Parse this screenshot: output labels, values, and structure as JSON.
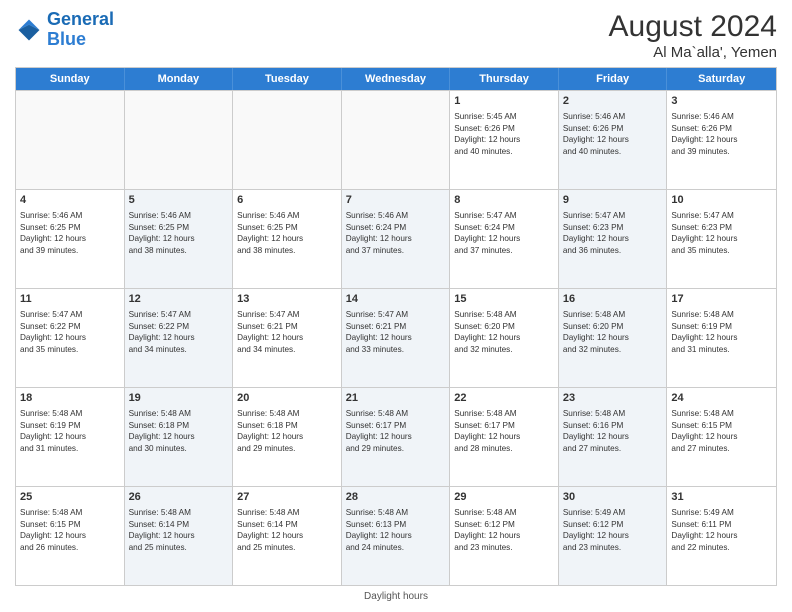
{
  "header": {
    "logo_line1": "General",
    "logo_line2": "Blue",
    "main_title": "August 2024",
    "sub_title": "Al Ma`alla', Yemen"
  },
  "weekdays": [
    "Sunday",
    "Monday",
    "Tuesday",
    "Wednesday",
    "Thursday",
    "Friday",
    "Saturday"
  ],
  "footer": {
    "daylight_label": "Daylight hours"
  },
  "rows": [
    [
      {
        "day": "",
        "empty": true,
        "shaded": false,
        "lines": []
      },
      {
        "day": "",
        "empty": true,
        "shaded": false,
        "lines": []
      },
      {
        "day": "",
        "empty": true,
        "shaded": false,
        "lines": []
      },
      {
        "day": "",
        "empty": true,
        "shaded": false,
        "lines": []
      },
      {
        "day": "1",
        "empty": false,
        "shaded": false,
        "lines": [
          "Sunrise: 5:45 AM",
          "Sunset: 6:26 PM",
          "Daylight: 12 hours",
          "and 40 minutes."
        ]
      },
      {
        "day": "2",
        "empty": false,
        "shaded": true,
        "lines": [
          "Sunrise: 5:46 AM",
          "Sunset: 6:26 PM",
          "Daylight: 12 hours",
          "and 40 minutes."
        ]
      },
      {
        "day": "3",
        "empty": false,
        "shaded": false,
        "lines": [
          "Sunrise: 5:46 AM",
          "Sunset: 6:26 PM",
          "Daylight: 12 hours",
          "and 39 minutes."
        ]
      }
    ],
    [
      {
        "day": "4",
        "empty": false,
        "shaded": false,
        "lines": [
          "Sunrise: 5:46 AM",
          "Sunset: 6:25 PM",
          "Daylight: 12 hours",
          "and 39 minutes."
        ]
      },
      {
        "day": "5",
        "empty": false,
        "shaded": true,
        "lines": [
          "Sunrise: 5:46 AM",
          "Sunset: 6:25 PM",
          "Daylight: 12 hours",
          "and 38 minutes."
        ]
      },
      {
        "day": "6",
        "empty": false,
        "shaded": false,
        "lines": [
          "Sunrise: 5:46 AM",
          "Sunset: 6:25 PM",
          "Daylight: 12 hours",
          "and 38 minutes."
        ]
      },
      {
        "day": "7",
        "empty": false,
        "shaded": true,
        "lines": [
          "Sunrise: 5:46 AM",
          "Sunset: 6:24 PM",
          "Daylight: 12 hours",
          "and 37 minutes."
        ]
      },
      {
        "day": "8",
        "empty": false,
        "shaded": false,
        "lines": [
          "Sunrise: 5:47 AM",
          "Sunset: 6:24 PM",
          "Daylight: 12 hours",
          "and 37 minutes."
        ]
      },
      {
        "day": "9",
        "empty": false,
        "shaded": true,
        "lines": [
          "Sunrise: 5:47 AM",
          "Sunset: 6:23 PM",
          "Daylight: 12 hours",
          "and 36 minutes."
        ]
      },
      {
        "day": "10",
        "empty": false,
        "shaded": false,
        "lines": [
          "Sunrise: 5:47 AM",
          "Sunset: 6:23 PM",
          "Daylight: 12 hours",
          "and 35 minutes."
        ]
      }
    ],
    [
      {
        "day": "11",
        "empty": false,
        "shaded": false,
        "lines": [
          "Sunrise: 5:47 AM",
          "Sunset: 6:22 PM",
          "Daylight: 12 hours",
          "and 35 minutes."
        ]
      },
      {
        "day": "12",
        "empty": false,
        "shaded": true,
        "lines": [
          "Sunrise: 5:47 AM",
          "Sunset: 6:22 PM",
          "Daylight: 12 hours",
          "and 34 minutes."
        ]
      },
      {
        "day": "13",
        "empty": false,
        "shaded": false,
        "lines": [
          "Sunrise: 5:47 AM",
          "Sunset: 6:21 PM",
          "Daylight: 12 hours",
          "and 34 minutes."
        ]
      },
      {
        "day": "14",
        "empty": false,
        "shaded": true,
        "lines": [
          "Sunrise: 5:47 AM",
          "Sunset: 6:21 PM",
          "Daylight: 12 hours",
          "and 33 minutes."
        ]
      },
      {
        "day": "15",
        "empty": false,
        "shaded": false,
        "lines": [
          "Sunrise: 5:48 AM",
          "Sunset: 6:20 PM",
          "Daylight: 12 hours",
          "and 32 minutes."
        ]
      },
      {
        "day": "16",
        "empty": false,
        "shaded": true,
        "lines": [
          "Sunrise: 5:48 AM",
          "Sunset: 6:20 PM",
          "Daylight: 12 hours",
          "and 32 minutes."
        ]
      },
      {
        "day": "17",
        "empty": false,
        "shaded": false,
        "lines": [
          "Sunrise: 5:48 AM",
          "Sunset: 6:19 PM",
          "Daylight: 12 hours",
          "and 31 minutes."
        ]
      }
    ],
    [
      {
        "day": "18",
        "empty": false,
        "shaded": false,
        "lines": [
          "Sunrise: 5:48 AM",
          "Sunset: 6:19 PM",
          "Daylight: 12 hours",
          "and 31 minutes."
        ]
      },
      {
        "day": "19",
        "empty": false,
        "shaded": true,
        "lines": [
          "Sunrise: 5:48 AM",
          "Sunset: 6:18 PM",
          "Daylight: 12 hours",
          "and 30 minutes."
        ]
      },
      {
        "day": "20",
        "empty": false,
        "shaded": false,
        "lines": [
          "Sunrise: 5:48 AM",
          "Sunset: 6:18 PM",
          "Daylight: 12 hours",
          "and 29 minutes."
        ]
      },
      {
        "day": "21",
        "empty": false,
        "shaded": true,
        "lines": [
          "Sunrise: 5:48 AM",
          "Sunset: 6:17 PM",
          "Daylight: 12 hours",
          "and 29 minutes."
        ]
      },
      {
        "day": "22",
        "empty": false,
        "shaded": false,
        "lines": [
          "Sunrise: 5:48 AM",
          "Sunset: 6:17 PM",
          "Daylight: 12 hours",
          "and 28 minutes."
        ]
      },
      {
        "day": "23",
        "empty": false,
        "shaded": true,
        "lines": [
          "Sunrise: 5:48 AM",
          "Sunset: 6:16 PM",
          "Daylight: 12 hours",
          "and 27 minutes."
        ]
      },
      {
        "day": "24",
        "empty": false,
        "shaded": false,
        "lines": [
          "Sunrise: 5:48 AM",
          "Sunset: 6:15 PM",
          "Daylight: 12 hours",
          "and 27 minutes."
        ]
      }
    ],
    [
      {
        "day": "25",
        "empty": false,
        "shaded": false,
        "lines": [
          "Sunrise: 5:48 AM",
          "Sunset: 6:15 PM",
          "Daylight: 12 hours",
          "and 26 minutes."
        ]
      },
      {
        "day": "26",
        "empty": false,
        "shaded": true,
        "lines": [
          "Sunrise: 5:48 AM",
          "Sunset: 6:14 PM",
          "Daylight: 12 hours",
          "and 25 minutes."
        ]
      },
      {
        "day": "27",
        "empty": false,
        "shaded": false,
        "lines": [
          "Sunrise: 5:48 AM",
          "Sunset: 6:14 PM",
          "Daylight: 12 hours",
          "and 25 minutes."
        ]
      },
      {
        "day": "28",
        "empty": false,
        "shaded": true,
        "lines": [
          "Sunrise: 5:48 AM",
          "Sunset: 6:13 PM",
          "Daylight: 12 hours",
          "and 24 minutes."
        ]
      },
      {
        "day": "29",
        "empty": false,
        "shaded": false,
        "lines": [
          "Sunrise: 5:48 AM",
          "Sunset: 6:12 PM",
          "Daylight: 12 hours",
          "and 23 minutes."
        ]
      },
      {
        "day": "30",
        "empty": false,
        "shaded": true,
        "lines": [
          "Sunrise: 5:49 AM",
          "Sunset: 6:12 PM",
          "Daylight: 12 hours",
          "and 23 minutes."
        ]
      },
      {
        "day": "31",
        "empty": false,
        "shaded": false,
        "lines": [
          "Sunrise: 5:49 AM",
          "Sunset: 6:11 PM",
          "Daylight: 12 hours",
          "and 22 minutes."
        ]
      }
    ]
  ]
}
